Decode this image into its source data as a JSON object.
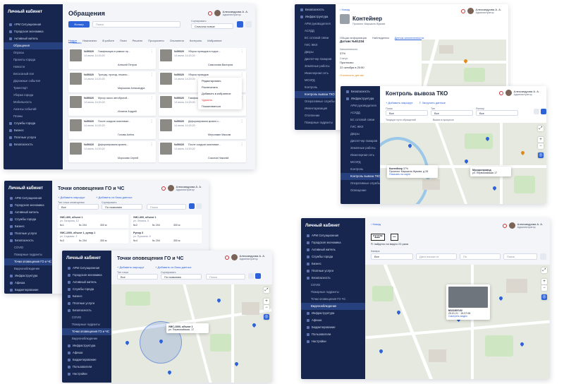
{
  "common": {
    "brand": "Личный кабинет",
    "user_name": "Александрова А. А.",
    "user_role": "Администратор",
    "search_placeholder": "Поиск"
  },
  "panel1": {
    "title": "Обращения",
    "filter_button": "Фильтр",
    "sort_label": "Сортировать",
    "sort_value": "Сначала новые",
    "print_label": "Печать",
    "tabs": [
      "Новые",
      "Назначено",
      "В работе",
      "План",
      "Решено",
      "Просрочено",
      "Отклонено",
      "Контроль",
      "Избранное"
    ],
    "nav": [
      {
        "label": "АРМ Ситуационная",
        "active": false,
        "sub": false
      },
      {
        "label": "Городская экономика",
        "active": false,
        "sub": false
      },
      {
        "label": "Активный житель",
        "active": false,
        "sub": false
      },
      {
        "label": "Обращения",
        "active": true,
        "sub": true
      },
      {
        "label": "Опросы",
        "active": false,
        "sub": true
      },
      {
        "label": "Проекты города",
        "active": false,
        "sub": true
      },
      {
        "label": "Новости",
        "active": false,
        "sub": true
      },
      {
        "label": "Бесхозный пол",
        "active": false,
        "sub": true
      },
      {
        "label": "Дорожные события",
        "active": false,
        "sub": true
      },
      {
        "label": "Транспорт",
        "active": false,
        "sub": true
      },
      {
        "label": "Уборка города",
        "active": false,
        "sub": true
      },
      {
        "label": "Мобильность",
        "active": false,
        "sub": true
      },
      {
        "label": "Анонсы событий",
        "active": false,
        "sub": true
      },
      {
        "label": "Планы",
        "active": false,
        "sub": true
      },
      {
        "label": "Службы города",
        "active": false,
        "sub": false
      },
      {
        "label": "Бизнес",
        "active": false,
        "sub": false
      },
      {
        "label": "Платные услуги",
        "active": false,
        "sub": false
      },
      {
        "label": "Безопасность",
        "active": false,
        "sub": false
      }
    ],
    "cards": [
      {
        "id": "№59320",
        "title": "Газификация в рамках пр...",
        "date": "14 июля, 14:20:20",
        "author": "Алексей Петров"
      },
      {
        "id": "№59320",
        "title": "Уборка проводов в подъе...",
        "date": "14 июля, 14:20:20",
        "author": "Самсонова Виктория"
      },
      {
        "id": "№59320",
        "title": "Тротуар, проезд, пешехо...",
        "date": "14 июля, 14:20:20",
        "author": "Мирошник Александра"
      },
      {
        "id": "№59320",
        "title": "Уборка проводов",
        "date": "14 июля, 14:20:20",
        "author": ""
      },
      {
        "id": "№59320",
        "title": "Мусор около автобусной...",
        "date": "14 июля, 14:20:20",
        "author": "Игнатов Андрей"
      },
      {
        "id": "№59320",
        "title": "Газификация",
        "date": "14 июля, 14:20:20",
        "author": ""
      },
      {
        "id": "№59320",
        "title": "После осадков скапливае...",
        "date": "14 июля, 14:20:20",
        "author": "Голова Алёна"
      },
      {
        "id": "№59320",
        "title": "Деформирована кровля с...",
        "date": "14 июля, 14:20:20",
        "author": "Мерзликин Максим"
      },
      {
        "id": "№59320",
        "title": "Деформирована кровля...",
        "date": "14 июля, 14:20:20",
        "author": "Морозова Сергей"
      },
      {
        "id": "№59320",
        "title": "После осадков скапливае...",
        "date": "14 июля, 14:20:20",
        "author": "Соколов Николай"
      }
    ],
    "context_menu": [
      "Редактировать",
      "Распечатать",
      "Добавить в избранное",
      "Удалить",
      "Пожаловаться"
    ]
  },
  "panel2": {
    "back": "Назад",
    "title": "Контейнер",
    "address": "Проспект Маршала Жукова",
    "tabs": [
      "Общая информация",
      "Наблюдения",
      "Датчик заполненности"
    ],
    "sensor_id": "Датчик №51234",
    "fill_label": "Заполненность",
    "fill_value": "37%",
    "status_label": "Статус",
    "status_value": "Прогнозно",
    "date_value": "22 октября в 20:50",
    "warning": "Отключить датчик",
    "nav": [
      "Безопасность",
      "Инфраструктура",
      "АРМ руководителя",
      "АСУДД",
      "БС сотовой связи",
      "ГИС ЖКХ",
      "Дворы",
      "Диспетчер пожаров",
      "Земляные работы",
      "Инженерная сеть",
      "МОЭГД",
      "Контроль",
      "Контроль вывоза ТКО",
      "Оперативные службы",
      "Инвентаризация",
      "Отопление",
      "Пожарные гидранты"
    ]
  },
  "panel3": {
    "title": "Контроль вывоза ТКО",
    "add_route": "Добавить маршрут",
    "load_data": "Загрузить данные",
    "search_label": "Поиск",
    "type_label": "Тип",
    "filter_label": "Фильтр",
    "all_value": "Все",
    "legend_a": "Текущие пути обращений",
    "legend_b": "Вывоз в процессе",
    "popup_title": "Контейнер",
    "popup_fill": "37%",
    "popup_line": "Проспект Маршала Жукова, д 26",
    "popup_note": "Показать на карте",
    "popup2_title": "Мусоропровод",
    "popup2_line": "ул. Первомайская 17"
  },
  "panel4": {
    "title": "Точки оповещения ГО и ЧС",
    "add_route": "Добавить маршрут",
    "add_data": "Добавить из базы данных",
    "place_label": "Тип точки оповещения",
    "place_value": "Все",
    "sort_label": "Сортировать",
    "sort_value": "По названию",
    "search_label": "Поиск",
    "nav": [
      {
        "label": "АРМ Ситуационная",
        "sub": false,
        "active": false
      },
      {
        "label": "Городская экономика",
        "sub": false,
        "active": false
      },
      {
        "label": "Активный житель",
        "sub": false,
        "active": false
      },
      {
        "label": "Службы города",
        "sub": false,
        "active": false
      },
      {
        "label": "Бизнес",
        "sub": false,
        "active": false
      },
      {
        "label": "Платные услуги",
        "sub": false,
        "active": false
      },
      {
        "label": "Безопасность",
        "sub": false,
        "active": false
      },
      {
        "label": "COVID",
        "sub": true,
        "active": false
      },
      {
        "label": "Пожарные гидранты",
        "sub": true,
        "active": false
      },
      {
        "label": "Точки оповещения ГО и ЧС",
        "sub": true,
        "active": true
      },
      {
        "label": "Видеонаблюдение",
        "sub": true,
        "active": false
      },
      {
        "label": "Инфраструктура",
        "sub": false,
        "active": false
      },
      {
        "label": "Афиша",
        "sub": false,
        "active": false
      },
      {
        "label": "Бюджетирование",
        "sub": false,
        "active": false
      },
      {
        "label": "Пользователи",
        "sub": false,
        "active": false
      },
      {
        "label": "Настройки",
        "sub": false,
        "active": false
      }
    ],
    "rows": [
      {
        "name": "УМС-300, объект 1",
        "addr": "ул. Гагарина, 12",
        "a": "№1",
        "b": "№ 204",
        "c": "300 м"
      },
      {
        "name": "УМС-300, объект 1",
        "addr": "ул. Ленина, 5",
        "a": "№2",
        "b": "№ 204",
        "c": "300 м"
      },
      {
        "name": "УМС-1000, объект 1, рупор 1",
        "addr": "ул. Садовая, 3",
        "a": "№3",
        "b": "№ 204",
        "c": "300 м"
      },
      {
        "name": "Рупор 3",
        "addr": "ул. Пушкина, 8",
        "a": "№4",
        "b": "№ 204",
        "c": "300 м"
      }
    ]
  },
  "panel5": {
    "title": "Точки оповещения ГО и ЧС",
    "add_route": "Добавить маршрут",
    "add_data": "Добавить из базы данных",
    "place_label": "Тип точки",
    "place_value": "Все",
    "sort_label": "Сортировать",
    "sort_value": "По названию",
    "search_label": "Поиск",
    "popup_title": "УМС-1000, объект 1",
    "popup_line": "ул. Первомайская, 17"
  },
  "panel6": {
    "back": "Назад",
    "plate_a": "*111**",
    "plate_b": "***",
    "found_text": "найдено на видео 23 раза",
    "camera_label": "Камера",
    "camera_value": "Все",
    "date_from": "Дата поиска от",
    "date_to": "По",
    "search_button": "Поиск",
    "popup_id": "М111МУ102",
    "popup_date": "25.01.21",
    "popup_time": "15:37:08",
    "popup_link": "Смотреть видео"
  }
}
